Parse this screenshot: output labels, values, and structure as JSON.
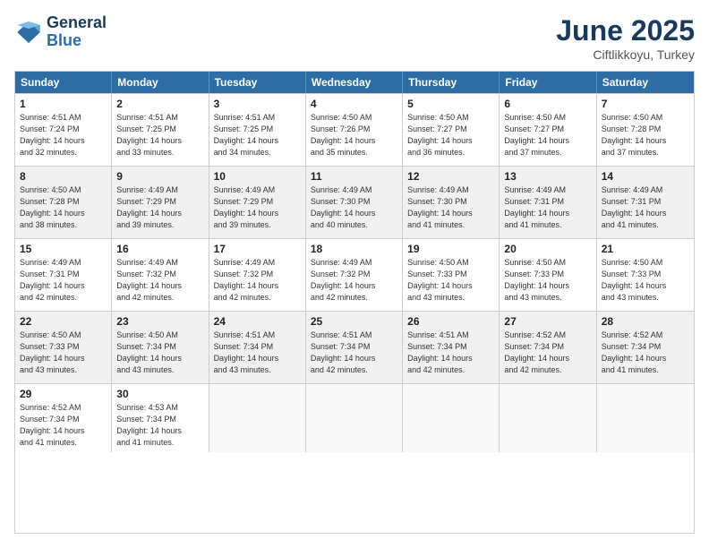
{
  "logo": {
    "line1": "General",
    "line2": "Blue"
  },
  "title": "June 2025",
  "subtitle": "Ciftlikkoyu, Turkey",
  "header_days": [
    "Sunday",
    "Monday",
    "Tuesday",
    "Wednesday",
    "Thursday",
    "Friday",
    "Saturday"
  ],
  "rows": [
    [
      {
        "day": "1",
        "info": "Sunrise: 4:51 AM\nSunset: 7:24 PM\nDaylight: 14 hours\nand 32 minutes."
      },
      {
        "day": "2",
        "info": "Sunrise: 4:51 AM\nSunset: 7:25 PM\nDaylight: 14 hours\nand 33 minutes."
      },
      {
        "day": "3",
        "info": "Sunrise: 4:51 AM\nSunset: 7:25 PM\nDaylight: 14 hours\nand 34 minutes."
      },
      {
        "day": "4",
        "info": "Sunrise: 4:50 AM\nSunset: 7:26 PM\nDaylight: 14 hours\nand 35 minutes."
      },
      {
        "day": "5",
        "info": "Sunrise: 4:50 AM\nSunset: 7:27 PM\nDaylight: 14 hours\nand 36 minutes."
      },
      {
        "day": "6",
        "info": "Sunrise: 4:50 AM\nSunset: 7:27 PM\nDaylight: 14 hours\nand 37 minutes."
      },
      {
        "day": "7",
        "info": "Sunrise: 4:50 AM\nSunset: 7:28 PM\nDaylight: 14 hours\nand 37 minutes."
      }
    ],
    [
      {
        "day": "8",
        "info": "Sunrise: 4:50 AM\nSunset: 7:28 PM\nDaylight: 14 hours\nand 38 minutes."
      },
      {
        "day": "9",
        "info": "Sunrise: 4:49 AM\nSunset: 7:29 PM\nDaylight: 14 hours\nand 39 minutes."
      },
      {
        "day": "10",
        "info": "Sunrise: 4:49 AM\nSunset: 7:29 PM\nDaylight: 14 hours\nand 39 minutes."
      },
      {
        "day": "11",
        "info": "Sunrise: 4:49 AM\nSunset: 7:30 PM\nDaylight: 14 hours\nand 40 minutes."
      },
      {
        "day": "12",
        "info": "Sunrise: 4:49 AM\nSunset: 7:30 PM\nDaylight: 14 hours\nand 41 minutes."
      },
      {
        "day": "13",
        "info": "Sunrise: 4:49 AM\nSunset: 7:31 PM\nDaylight: 14 hours\nand 41 minutes."
      },
      {
        "day": "14",
        "info": "Sunrise: 4:49 AM\nSunset: 7:31 PM\nDaylight: 14 hours\nand 41 minutes."
      }
    ],
    [
      {
        "day": "15",
        "info": "Sunrise: 4:49 AM\nSunset: 7:31 PM\nDaylight: 14 hours\nand 42 minutes."
      },
      {
        "day": "16",
        "info": "Sunrise: 4:49 AM\nSunset: 7:32 PM\nDaylight: 14 hours\nand 42 minutes."
      },
      {
        "day": "17",
        "info": "Sunrise: 4:49 AM\nSunset: 7:32 PM\nDaylight: 14 hours\nand 42 minutes."
      },
      {
        "day": "18",
        "info": "Sunrise: 4:49 AM\nSunset: 7:32 PM\nDaylight: 14 hours\nand 42 minutes."
      },
      {
        "day": "19",
        "info": "Sunrise: 4:50 AM\nSunset: 7:33 PM\nDaylight: 14 hours\nand 43 minutes."
      },
      {
        "day": "20",
        "info": "Sunrise: 4:50 AM\nSunset: 7:33 PM\nDaylight: 14 hours\nand 43 minutes."
      },
      {
        "day": "21",
        "info": "Sunrise: 4:50 AM\nSunset: 7:33 PM\nDaylight: 14 hours\nand 43 minutes."
      }
    ],
    [
      {
        "day": "22",
        "info": "Sunrise: 4:50 AM\nSunset: 7:33 PM\nDaylight: 14 hours\nand 43 minutes."
      },
      {
        "day": "23",
        "info": "Sunrise: 4:50 AM\nSunset: 7:34 PM\nDaylight: 14 hours\nand 43 minutes."
      },
      {
        "day": "24",
        "info": "Sunrise: 4:51 AM\nSunset: 7:34 PM\nDaylight: 14 hours\nand 43 minutes."
      },
      {
        "day": "25",
        "info": "Sunrise: 4:51 AM\nSunset: 7:34 PM\nDaylight: 14 hours\nand 42 minutes."
      },
      {
        "day": "26",
        "info": "Sunrise: 4:51 AM\nSunset: 7:34 PM\nDaylight: 14 hours\nand 42 minutes."
      },
      {
        "day": "27",
        "info": "Sunrise: 4:52 AM\nSunset: 7:34 PM\nDaylight: 14 hours\nand 42 minutes."
      },
      {
        "day": "28",
        "info": "Sunrise: 4:52 AM\nSunset: 7:34 PM\nDaylight: 14 hours\nand 41 minutes."
      }
    ],
    [
      {
        "day": "29",
        "info": "Sunrise: 4:52 AM\nSunset: 7:34 PM\nDaylight: 14 hours\nand 41 minutes."
      },
      {
        "day": "30",
        "info": "Sunrise: 4:53 AM\nSunset: 7:34 PM\nDaylight: 14 hours\nand 41 minutes."
      },
      {
        "day": "",
        "info": ""
      },
      {
        "day": "",
        "info": ""
      },
      {
        "day": "",
        "info": ""
      },
      {
        "day": "",
        "info": ""
      },
      {
        "day": "",
        "info": ""
      }
    ]
  ]
}
